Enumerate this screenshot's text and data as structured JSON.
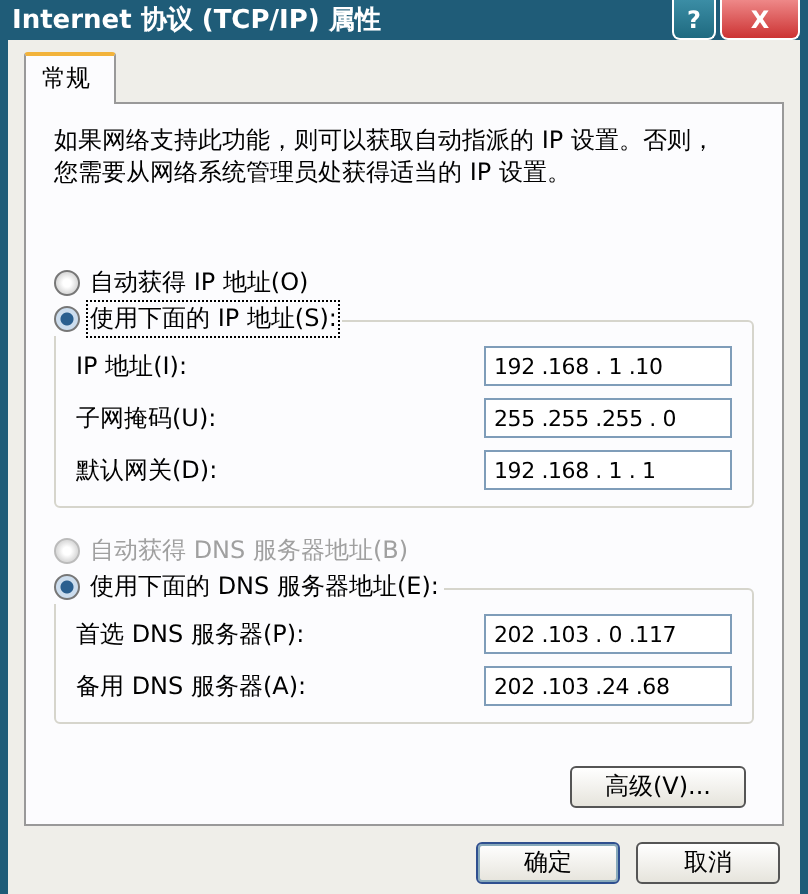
{
  "window": {
    "title": "Internet 协议 (TCP/IP) 属性",
    "controls": [
      {
        "kind": "help",
        "label": "?"
      },
      {
        "kind": "close",
        "label": "X"
      }
    ]
  },
  "tabs": [
    {
      "label": "常规",
      "selected": true
    }
  ],
  "description": [
    "如果网络支持此功能，则可以获取自动指派的 IP 设置。否则，",
    "您需要从网络系统管理员处获得适当的 IP 设置。"
  ],
  "sections": [
    {
      "radios": [
        {
          "label": "自动获得 IP 地址(O)",
          "selected": false,
          "disabled": false,
          "focused": false
        },
        {
          "label": "使用下面的 IP 地址(S):",
          "selected": true,
          "disabled": false,
          "focused": true
        }
      ],
      "fields": [
        {
          "label": "IP 地址(I):",
          "value": "192 .168 . 1 .10"
        },
        {
          "label": "子网掩码(U):",
          "value": "255 .255 .255 . 0"
        },
        {
          "label": "默认网关(D):",
          "value": "192 .168 . 1 . 1"
        }
      ]
    },
    {
      "radios": [
        {
          "label": "自动获得 DNS 服务器地址(B)",
          "selected": false,
          "disabled": true,
          "focused": false
        },
        {
          "label": "使用下面的 DNS 服务器地址(E):",
          "selected": true,
          "disabled": false,
          "focused": false
        }
      ],
      "fields": [
        {
          "label": "首选 DNS 服务器(P):",
          "value": "202 .103 . 0 .117"
        },
        {
          "label": "备用 DNS 服务器(A):",
          "value": "202 .103 .24 .68"
        }
      ]
    }
  ],
  "advanced_button": "高级(V)...",
  "buttons": [
    {
      "label": "确定",
      "default": true
    },
    {
      "label": "取消",
      "default": false
    }
  ]
}
